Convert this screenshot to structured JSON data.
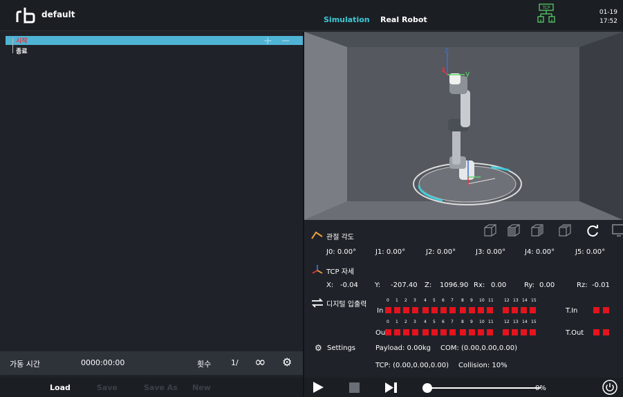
{
  "header": {
    "project": "default",
    "mode_sim": "Simulation",
    "mode_real": "Real Robot",
    "date": "01-19",
    "time": "17:52",
    "tcp_badge": "TCP"
  },
  "tree": {
    "start": "시작",
    "end": "종료",
    "add": "+",
    "remove": "−"
  },
  "run": {
    "label": "가동 시간",
    "time": "0000:00:00",
    "count_label": "횟수",
    "count": "1/",
    "infinite": "∞",
    "gear": "⚙"
  },
  "file": {
    "load": "Load",
    "save": "Save",
    "save_as": "Save As",
    "new": "New"
  },
  "joint": {
    "title": "관절 각도",
    "j0": "J0: 0.00°",
    "j1": "J1: 0.00°",
    "j2": "J2: 0.00°",
    "j3": "J3: 0.00°",
    "j4": "J4: 0.00°",
    "j5": "J5: 0.00°"
  },
  "tcp": {
    "title": "TCP 자세",
    "x_label": "X:",
    "x": "-0.04",
    "y_label": "Y:",
    "y": "-207.40",
    "z_label": "Z:",
    "z": "1096.90",
    "rx_label": "Rx:",
    "rx": "0.00",
    "ry_label": "Ry:",
    "ry": "0.00",
    "rz_label": "Rz:",
    "rz": "-0.01"
  },
  "io": {
    "title": "디지털 입출력",
    "in_label": "In",
    "out_label": "Out",
    "tin_label": "T.In",
    "tout_label": "T.Out",
    "nums": [
      "0",
      "1",
      "2",
      "3",
      "4",
      "5",
      "6",
      "7",
      "8",
      "9",
      "10",
      "11",
      "12",
      "13",
      "14",
      "15"
    ]
  },
  "settings": {
    "title": "Settings",
    "payload": "Payload: 0.00kg",
    "com": "COM: (0.00,0.00,0.00)",
    "tcp": "TCP: (0.00,0.00,0.00)",
    "collision": "Collision: 10%"
  },
  "control": {
    "speed": "0%",
    "speed_fraction": 0
  },
  "colors": {
    "accent": "#3ec9d6",
    "tree_header": "#4fb3d4",
    "led_off": "#e5131d",
    "start_red": "#e8353e"
  }
}
